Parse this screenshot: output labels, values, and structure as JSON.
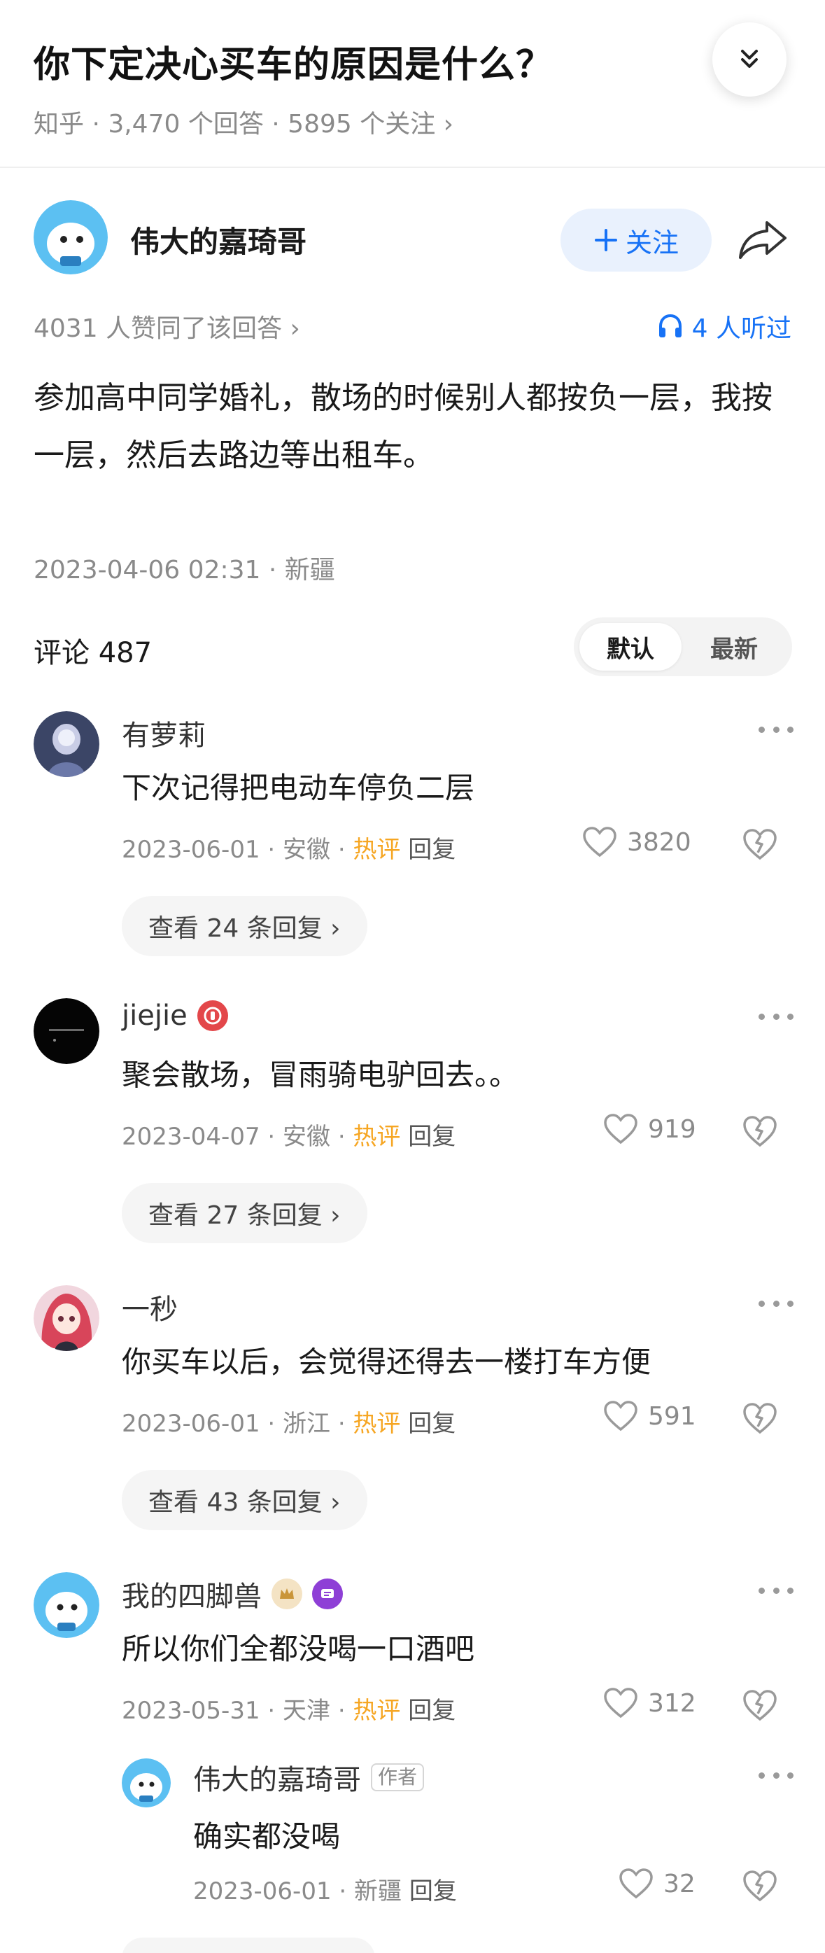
{
  "question": {
    "title": "你下定决心买车的原因是什么？",
    "meta": "知乎 · 3,470 个回答 · 5895 个关注 ›"
  },
  "answer": {
    "author": "伟大的嘉琦哥",
    "follow_label": "关注",
    "agree_text": "4031 人赞同了该回答 ›",
    "listened_text": "4 人听过",
    "content": "参加高中同学婚礼，散场的时候别人都按负一层，我按一层，然后去路边等出租车。",
    "time_location": "2023-04-06 02:31 · 新疆"
  },
  "comments_header": {
    "count_label": "评论 487",
    "sort_default": "默认",
    "sort_latest": "最新"
  },
  "comments": [
    {
      "name": "有萝莉",
      "text": "下次记得把电动车停负二层",
      "date_loc": "2023-06-01 · 安徽 · ",
      "hot": "热评",
      "reply": "回复",
      "likes": "3820",
      "view_replies": "查看 24 条回复 ›"
    },
    {
      "name": "jiejie",
      "text": "聚会散场，冒雨骑电驴回去。。",
      "date_loc": "2023-04-07 · 安徽 · ",
      "hot": "热评",
      "reply": "回复",
      "likes": "919",
      "view_replies": "查看 27 条回复 ›"
    },
    {
      "name": "一秒",
      "text": "你买车以后，会觉得还得去一楼打车方便",
      "date_loc": "2023-06-01 · 浙江 · ",
      "hot": "热评",
      "reply": "回复",
      "likes": "591",
      "view_replies": "查看 43 条回复 ›"
    },
    {
      "name": "我的四脚兽",
      "text": "所以你们全都没喝一口酒吧",
      "date_loc": "2023-05-31 · 天津 · ",
      "hot": "热评",
      "reply": "回复",
      "likes": "312"
    }
  ],
  "sub_reply": {
    "name": "伟大的嘉琦哥",
    "author_tag": "作者",
    "text": "确实都没喝",
    "date_loc": "2023-06-01 · 新疆 ",
    "reply": "回复",
    "likes": "32"
  },
  "colors": {
    "accent_blue": "#1772f6",
    "hot_orange": "#f6a623",
    "follow_bg": "#e9f1fd"
  }
}
